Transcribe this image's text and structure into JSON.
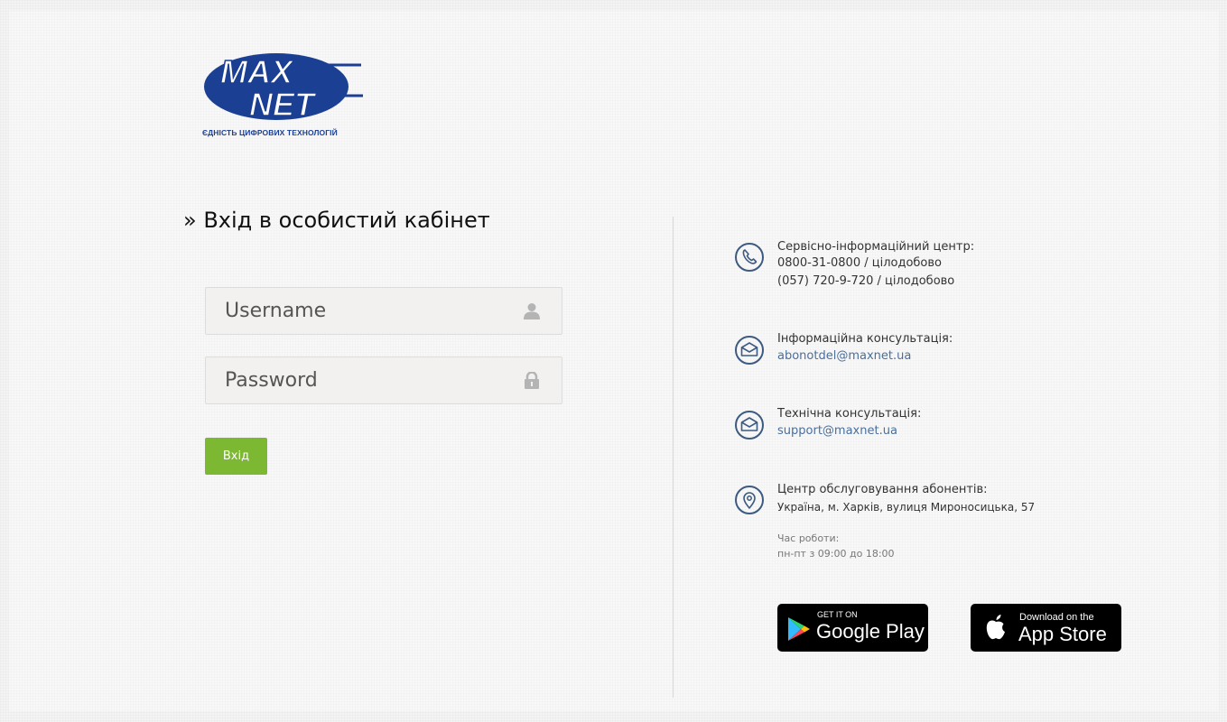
{
  "logo": {
    "wordmark_top": "MAX",
    "wordmark_bottom": "NET",
    "tagline": "ЄДНІСТЬ ЦИФРОВИХ ТЕХНОЛОГІЙ",
    "brand_color": "#1b3f93"
  },
  "login": {
    "title": "» Вхід в особистий кабінет",
    "username_placeholder": "Username",
    "password_placeholder": "Password",
    "submit_label": "Вхід",
    "submit_color": "#7cb832"
  },
  "contacts": {
    "service": {
      "icon": "phone-icon",
      "title": "Сервісно-інформаційний центр:",
      "line1": "0800-31-0800 / цілодобово",
      "line2": "(057) 720-9-720 / цілодобово"
    },
    "info": {
      "icon": "mail-icon",
      "title": "Інформаційна консультація:",
      "email": "abonotdel@maxnet.ua"
    },
    "tech": {
      "icon": "mail-icon",
      "title": "Технічна консультація:",
      "email": "support@maxnet.ua"
    },
    "office": {
      "icon": "location-pin-icon",
      "title": "Центр обслуговування абонентів:",
      "address": "Україна, м. Харків, вулиця Мироносицька, 57",
      "hours_label": "Час роботи:",
      "hours": "пн-пт з 09:00 до 18:00"
    },
    "link_color": "#4a6f9d"
  },
  "stores": {
    "google_small": "GET IT ON",
    "google_big": "Google Play",
    "apple_small": "Download on the",
    "apple_big": "App Store"
  }
}
